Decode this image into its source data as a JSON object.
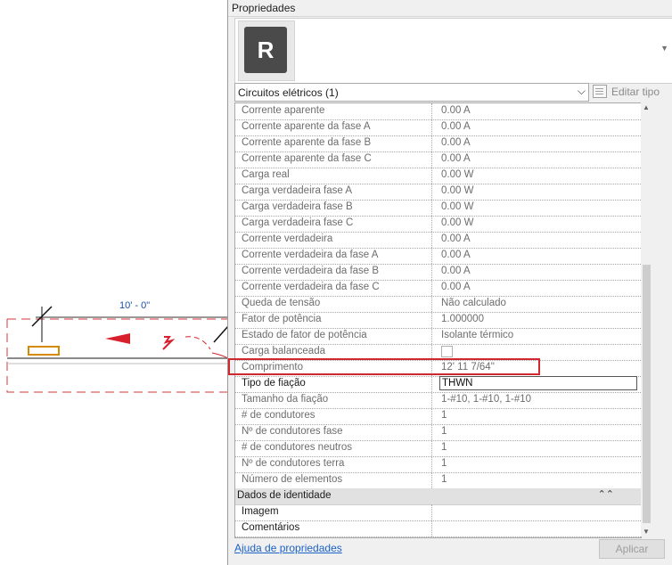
{
  "drawing": {
    "dimension_label": "10' - 0\""
  },
  "palette": {
    "title": "Propriedades",
    "type_selector": "Circuitos elétricos (1)",
    "edit_type": "Editar tipo",
    "rows": [
      {
        "label": "Corrente aparente",
        "value": "0.00 A"
      },
      {
        "label": "Corrente aparente da fase A",
        "value": "0.00 A"
      },
      {
        "label": "Corrente aparente da fase B",
        "value": "0.00 A"
      },
      {
        "label": "Corrente aparente da fase C",
        "value": "0.00 A"
      },
      {
        "label": "Carga real",
        "value": "0.00 W"
      },
      {
        "label": "Carga verdadeira fase A",
        "value": "0.00 W"
      },
      {
        "label": "Carga verdadeira fase B",
        "value": "0.00 W"
      },
      {
        "label": "Carga verdadeira fase C",
        "value": "0.00 W"
      },
      {
        "label": "Corrente verdadeira",
        "value": "0.00 A"
      },
      {
        "label": "Corrente verdadeira da fase A",
        "value": "0.00 A"
      },
      {
        "label": "Corrente verdadeira da fase B",
        "value": "0.00 A"
      },
      {
        "label": "Corrente verdadeira da fase C",
        "value": "0.00 A"
      },
      {
        "label": "Queda de tensão",
        "value": "Não calculado"
      },
      {
        "label": "Fator de potência",
        "value": "1.000000"
      },
      {
        "label": "Estado de fator de potência",
        "value": "Isolante térmico"
      },
      {
        "label": "Carga balanceada",
        "value": ""
      },
      {
        "label": "Comprimento",
        "value": "12'  11 7/64\""
      },
      {
        "label": "Tipo de fiação",
        "value": "THWN"
      },
      {
        "label": "Tamanho da fiação",
        "value": "1-#10, 1-#10, 1-#10"
      },
      {
        "label": "# de condutores",
        "value": "1"
      },
      {
        "label": "Nº de condutores fase",
        "value": "1"
      },
      {
        "label": "# de condutores neutros",
        "value": "1"
      },
      {
        "label": "Nº de condutores terra",
        "value": "1"
      },
      {
        "label": "Número de elementos",
        "value": "1"
      }
    ],
    "section_identity": "Dados de identidade",
    "identity_rows": [
      {
        "label": "Imagem",
        "value": ""
      },
      {
        "label": "Comentários",
        "value": ""
      }
    ],
    "help_link": "Ajuda de propriedades",
    "apply_button": "Aplicar"
  }
}
